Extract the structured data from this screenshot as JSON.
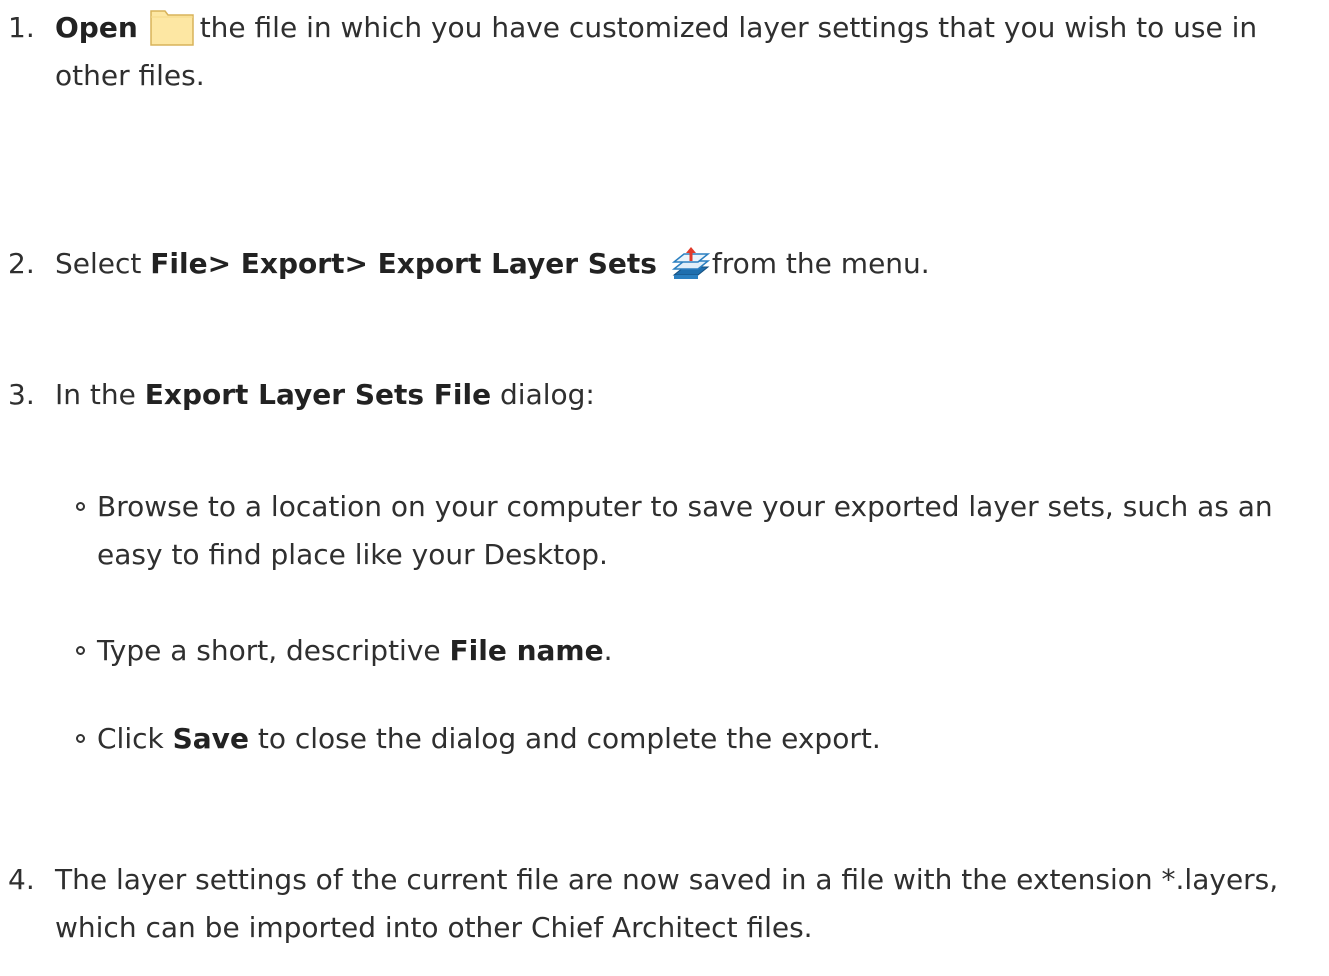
{
  "steps": [
    {
      "number": "1.",
      "bold": "Open",
      "icon": "folder-open-icon",
      "rest": "the file in which you have customized layer settings that you wish to use in other files."
    },
    {
      "number": "2.",
      "prefix": "Select ",
      "bold": "File> Export> Export Layer Sets",
      "icon": "export-layer-sets-icon",
      "rest": "from the menu."
    },
    {
      "number": "3.",
      "prefix": "In the ",
      "bold": "Export Layer Sets File",
      "rest": " dialog:",
      "bullets": [
        {
          "text": "Browse to a location on your computer to save your exported layer sets, such as an easy to find place like your Desktop."
        },
        {
          "prefix": "Type a short, descriptive ",
          "bold": "File name",
          "rest": "."
        },
        {
          "prefix": "Click ",
          "bold": "Save",
          "rest": " to close the dialog and complete the export."
        }
      ]
    },
    {
      "number": "4.",
      "text": "The layer settings of the current file are now saved in a file with the extension *.layers, which can be imported into other Chief Architect files."
    }
  ],
  "colors": {
    "text": "#2f2f2f",
    "folder_fill": "#fde7a3",
    "folder_stroke": "#d8b35a",
    "icon_blue": "#2a7fc0",
    "icon_red": "#e03a2a"
  }
}
